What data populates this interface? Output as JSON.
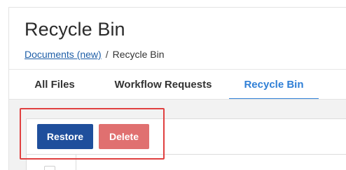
{
  "header": {
    "title": "Recycle Bin",
    "breadcrumb": {
      "parent_label": "Documents (new)",
      "separator": "/",
      "current_label": "Recycle Bin"
    }
  },
  "tabs": [
    {
      "label": "All Files",
      "active": false
    },
    {
      "label": "Workflow Requests",
      "active": false
    },
    {
      "label": "Recycle Bin",
      "active": true
    }
  ],
  "toolbar": {
    "restore_label": "Restore",
    "delete_label": "Delete"
  },
  "colors": {
    "accent": "#2f7fd6",
    "restore_button": "#1f4f9c",
    "delete_button": "#e07070",
    "highlight": "#e04040",
    "link": "#1f5fa8"
  }
}
